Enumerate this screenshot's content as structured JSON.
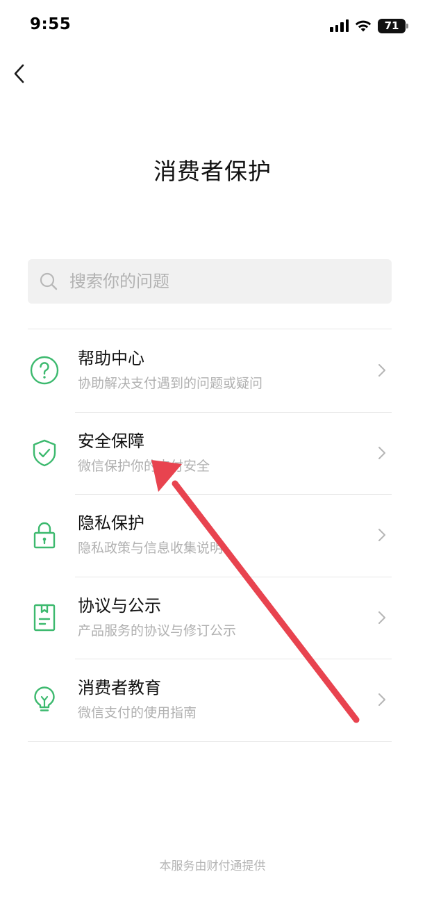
{
  "status_bar": {
    "time": "9:55",
    "battery": "71",
    "icons": [
      "signal-icon",
      "wifi-icon",
      "battery-icon"
    ]
  },
  "nav": {
    "back_icon": "chevron-left-icon"
  },
  "page": {
    "title": "消费者保护"
  },
  "search": {
    "placeholder": "搜索你的问题",
    "icon": "search-icon"
  },
  "menu": {
    "items": [
      {
        "title": "帮助中心",
        "desc": "协助解决支付遇到的问题或疑问",
        "icon": "question-circle-icon"
      },
      {
        "title": "安全保障",
        "desc": "微信保护你的支付安全",
        "icon": "shield-check-icon"
      },
      {
        "title": "隐私保护",
        "desc": "隐私政策与信息收集说明",
        "icon": "lock-icon"
      },
      {
        "title": "协议与公示",
        "desc": "产品服务的协议与修订公示",
        "icon": "document-icon"
      },
      {
        "title": "消费者教育",
        "desc": "微信支付的使用指南",
        "icon": "lightbulb-icon"
      }
    ]
  },
  "footer": {
    "text": "本服务由财付通提供"
  },
  "colors": {
    "accent": "#3cb96e",
    "annotation_arrow": "#e8434f",
    "secondary_text": "#b0b0b0",
    "divider": "#e6e6e6",
    "search_bg": "#f1f1f1"
  }
}
